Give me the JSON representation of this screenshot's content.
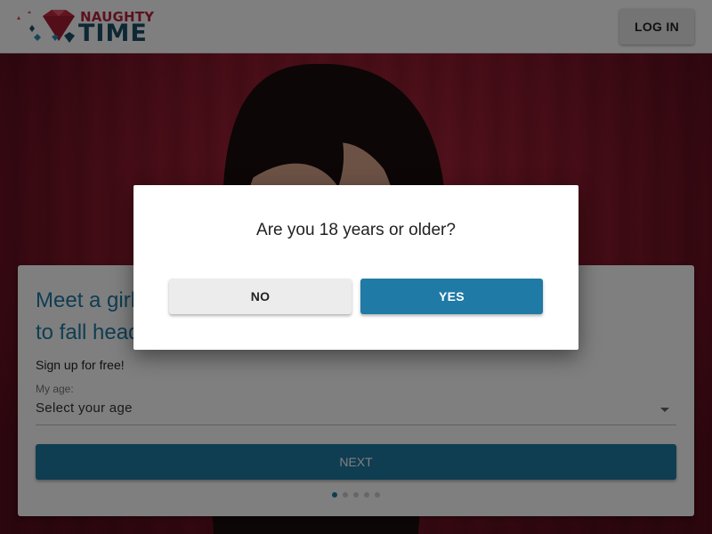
{
  "header": {
    "logo_top": "NAUGHTY",
    "logo_bottom": "TIME",
    "login_label": "LOG IN"
  },
  "signup_card": {
    "title_line1": "Meet a girl",
    "title_line2": "to fall head over heels",
    "signup_text": "Sign up for free!",
    "age_label": "My age:",
    "age_select_value": "Select your age",
    "next_label": "NEXT",
    "step_dots": 5,
    "active_step": 1
  },
  "age_modal": {
    "question": "Are you 18 years or older?",
    "no_label": "NO",
    "yes_label": "YES"
  },
  "colors": {
    "brand_blue": "#1f7aa5",
    "brand_red": "#b8253d",
    "logo_navy": "#1d4e68",
    "hero_background": "#8e1a2e"
  },
  "icons": [
    "diamond-logo-icon",
    "chevron-down-icon"
  ]
}
